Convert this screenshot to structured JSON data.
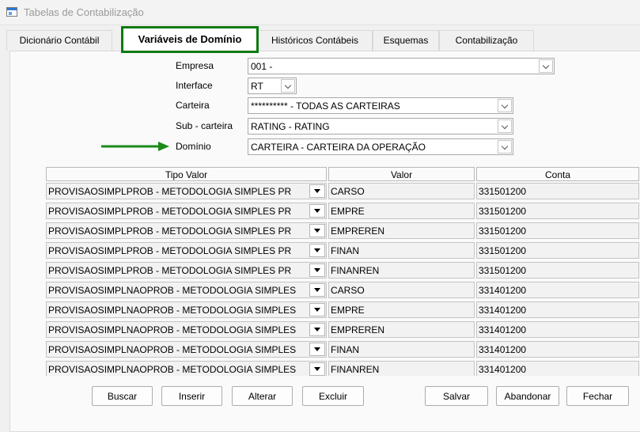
{
  "window": {
    "title": "Tabelas de Contabilização"
  },
  "tabs": [
    {
      "label": "Dicionário Contábil"
    },
    {
      "label": "Variáveis de Domínio"
    },
    {
      "label": "Históricos Contábeis"
    },
    {
      "label": "Esquemas"
    },
    {
      "label": "Contabilização"
    }
  ],
  "form": {
    "empresa": {
      "label": "Empresa",
      "value": "001 -"
    },
    "interface": {
      "label": "Interface",
      "value": "RT"
    },
    "carteira": {
      "label": "Carteira",
      "value": "********** - TODAS AS CARTEIRAS"
    },
    "subcarteira": {
      "label": "Sub - carteira",
      "value": "RATING - RATING"
    },
    "dominio": {
      "label": "Domínio",
      "value": "CARTEIRA - CARTEIRA DA OPERAÇÃO"
    }
  },
  "grid": {
    "columns": [
      "Tipo Valor",
      "Valor",
      "Conta"
    ],
    "rows": [
      {
        "tipo": "PROVISAOSIMPLPROB - METODOLOGIA SIMPLES PR",
        "valor": "CARSO",
        "conta": "331501200"
      },
      {
        "tipo": "PROVISAOSIMPLPROB - METODOLOGIA SIMPLES PR",
        "valor": "EMPRE",
        "conta": "331501200"
      },
      {
        "tipo": "PROVISAOSIMPLPROB - METODOLOGIA SIMPLES PR",
        "valor": "EMPREREN",
        "conta": "331501200"
      },
      {
        "tipo": "PROVISAOSIMPLPROB - METODOLOGIA SIMPLES PR",
        "valor": "FINAN",
        "conta": "331501200"
      },
      {
        "tipo": "PROVISAOSIMPLPROB - METODOLOGIA SIMPLES PR",
        "valor": "FINANREN",
        "conta": "331501200"
      },
      {
        "tipo": "PROVISAOSIMPLNAOPROB - METODOLOGIA SIMPLES",
        "valor": "CARSO",
        "conta": "331401200"
      },
      {
        "tipo": "PROVISAOSIMPLNAOPROB - METODOLOGIA SIMPLES",
        "valor": "EMPRE",
        "conta": "331401200"
      },
      {
        "tipo": "PROVISAOSIMPLNAOPROB - METODOLOGIA SIMPLES",
        "valor": "EMPREREN",
        "conta": "331401200"
      },
      {
        "tipo": "PROVISAOSIMPLNAOPROB - METODOLOGIA SIMPLES",
        "valor": "FINAN",
        "conta": "331401200"
      },
      {
        "tipo": "PROVISAOSIMPLNAOPROB - METODOLOGIA SIMPLES",
        "valor": "FINANREN",
        "conta": "331401200"
      }
    ]
  },
  "buttons": {
    "buscar": "Buscar",
    "inserir": "Inserir",
    "alterar": "Alterar",
    "excluir": "Excluir",
    "salvar": "Salvar",
    "abandonar": "Abandonar",
    "fechar": "Fechar"
  },
  "colors": {
    "highlight": "#0a7a12",
    "arrow": "#1a8a1a"
  }
}
